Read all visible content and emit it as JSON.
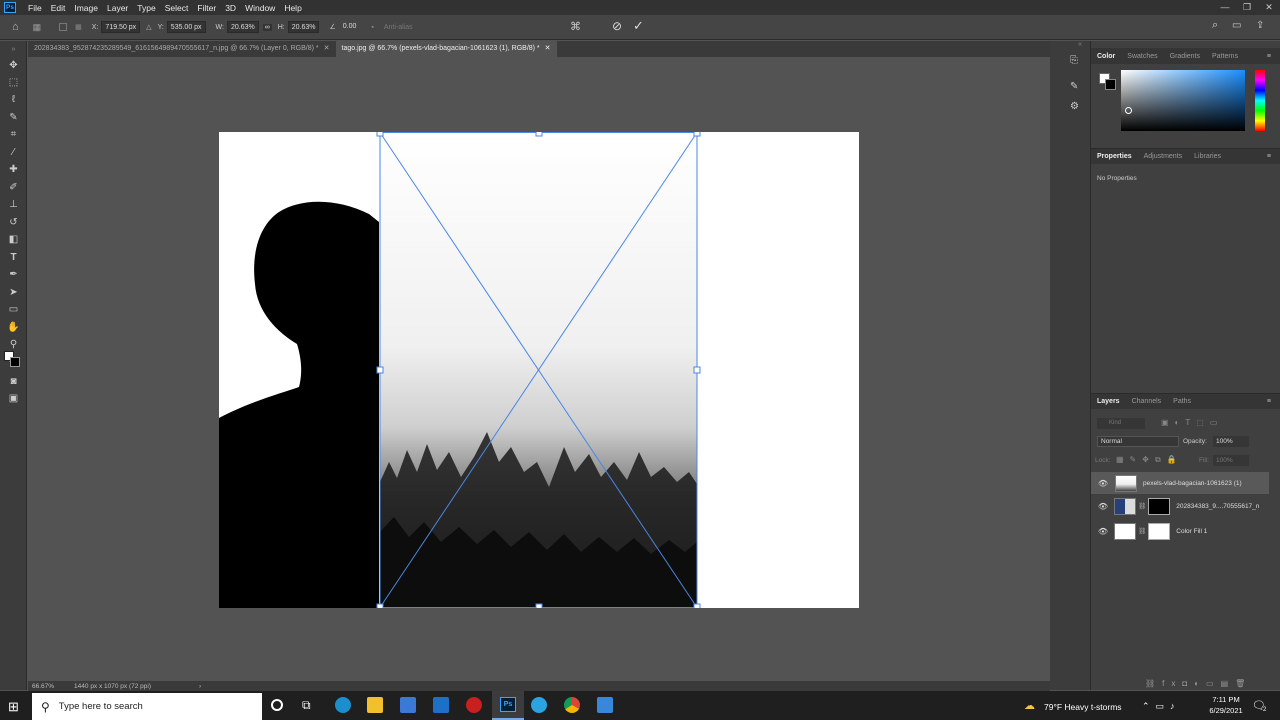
{
  "app": {
    "logo": "Ps"
  },
  "menu": [
    "File",
    "Edit",
    "Image",
    "Layer",
    "Type",
    "Select",
    "Filter",
    "3D",
    "Window",
    "Help"
  ],
  "options": {
    "x_label": "X:",
    "x_value": "719.50 px",
    "y_label": "Y:",
    "y_value": "535.00 px",
    "w_label": "W:",
    "w_value": "20.63%",
    "h_label": "H:",
    "h_value": "20.63%",
    "angle_value": "0.00",
    "antialias": "Anti-alias"
  },
  "tabs": [
    {
      "label": "202834383_952874235289549_6161564989470555617_n.jpg @ 66.7% (Layer 0, RGB/8) *"
    },
    {
      "label": "tago.jpg @ 66.7% (pexels-vlad-bagacian-1061623 (1), RGB/8) *"
    }
  ],
  "status": {
    "zoom": "66.67%",
    "doc_size": "1440 px x 1070 px (72 ppi)"
  },
  "color_panel": {
    "tabs": [
      "Color",
      "Swatches",
      "Gradients",
      "Patterns"
    ]
  },
  "properties_panel": {
    "tabs": [
      "Properties",
      "Adjustments",
      "Libraries"
    ],
    "empty_text": "No Properties"
  },
  "layers_panel": {
    "tabs": [
      "Layers",
      "Channels",
      "Paths"
    ],
    "kind_placeholder": "Kind",
    "blend_mode": "Normal",
    "opacity_label": "Opacity:",
    "opacity_value": "100%",
    "lock_label": "Lock:",
    "fill_label": "Fill:",
    "fill_value": "100%",
    "layers": [
      {
        "name": "pexels-vlad-bagacian-1061623 (1)"
      },
      {
        "name": "202834383_9....70555617_n"
      },
      {
        "name": "Color Fill 1"
      }
    ]
  },
  "taskbar": {
    "search_placeholder": "Type here to search",
    "weather": "79°F  Heavy t-storms",
    "time": "7:11 PM",
    "date": "6/29/2021",
    "notification_count": "2"
  }
}
